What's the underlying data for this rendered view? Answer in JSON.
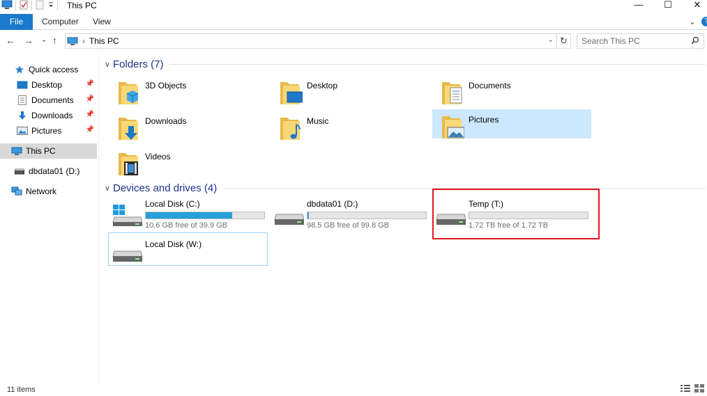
{
  "window": {
    "title": "This PC",
    "minimize": "—",
    "maximize": "☐",
    "close": "✕"
  },
  "ribbon": {
    "tabs": [
      "File",
      "Computer",
      "View"
    ],
    "collapse_glyph": "⌄",
    "help_glyph": "?"
  },
  "nav": {
    "back": "←",
    "forward": "→",
    "recent": "⌄",
    "up": "↑",
    "address": "This PC",
    "address_separator": "›",
    "search_placeholder": "Search This PC"
  },
  "sidebar": {
    "quick_access": "Quick access",
    "items": [
      {
        "label": "Desktop",
        "icon": "desktop-icon",
        "pinned": true
      },
      {
        "label": "Documents",
        "icon": "documents-icon",
        "pinned": true
      },
      {
        "label": "Downloads",
        "icon": "downloads-icon",
        "pinned": true
      },
      {
        "label": "Pictures",
        "icon": "pictures-icon",
        "pinned": true
      }
    ],
    "this_pc": "This PC",
    "drive": "dbdata01 (D:)",
    "network": "Network"
  },
  "folders": {
    "heading": "Folders (7)",
    "items": [
      "3D Objects",
      "Desktop",
      "Documents",
      "Downloads",
      "Music",
      "Pictures",
      "Videos"
    ]
  },
  "drives": {
    "heading": "Devices and drives (4)",
    "items": [
      {
        "name": "Local Disk (C:)",
        "free_text": "10.6 GB free of 39.9 GB",
        "used_fraction": 0.73,
        "has_bar": true
      },
      {
        "name": "dbdata01 (D:)",
        "free_text": "98.5 GB free of 99.8 GB",
        "used_fraction": 0.013,
        "has_bar": true
      },
      {
        "name": "Temp (T:)",
        "free_text": "1.72 TB free of 1.72 TB",
        "used_fraction": 0.0,
        "has_bar": true
      },
      {
        "name": "Local Disk (W:)",
        "free_text": "",
        "used_fraction": 0,
        "has_bar": false
      }
    ]
  },
  "status": {
    "item_count": "11 items"
  },
  "colors": {
    "accent": "#1979ca",
    "selection": "#cce8ff",
    "bar_fill": "#26a0da",
    "highlight_box": "#e3141b"
  }
}
